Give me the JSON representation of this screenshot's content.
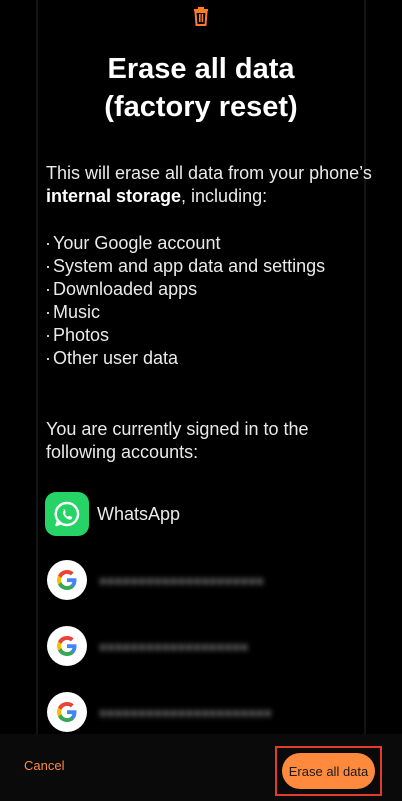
{
  "dialog": {
    "title_line1": "Erase all data",
    "title_line2": "(factory reset)",
    "description_part1": "This will erase all data from your phone’s ",
    "description_bold": "internal storage",
    "description_part2": ", including:",
    "bullets": [
      "Your Google account",
      "System and app data and settings",
      "Downloaded apps",
      "Music",
      "Photos",
      "Other user data"
    ],
    "signed_in_text": "You are currently signed in to the following accounts:",
    "accounts": [
      {
        "type": "whatsapp",
        "label": "WhatsApp",
        "icon": "whatsapp-icon"
      },
      {
        "type": "google",
        "label": "",
        "icon": "google-icon"
      },
      {
        "type": "google",
        "label": "",
        "icon": "google-icon"
      },
      {
        "type": "google",
        "label": "",
        "icon": "google-icon"
      }
    ]
  },
  "footer": {
    "cancel_label": "Cancel",
    "erase_label": "Erase all data"
  },
  "colors": {
    "accent": "#ff8a3d",
    "highlight_frame": "#e23b2e",
    "background": "#000000"
  }
}
